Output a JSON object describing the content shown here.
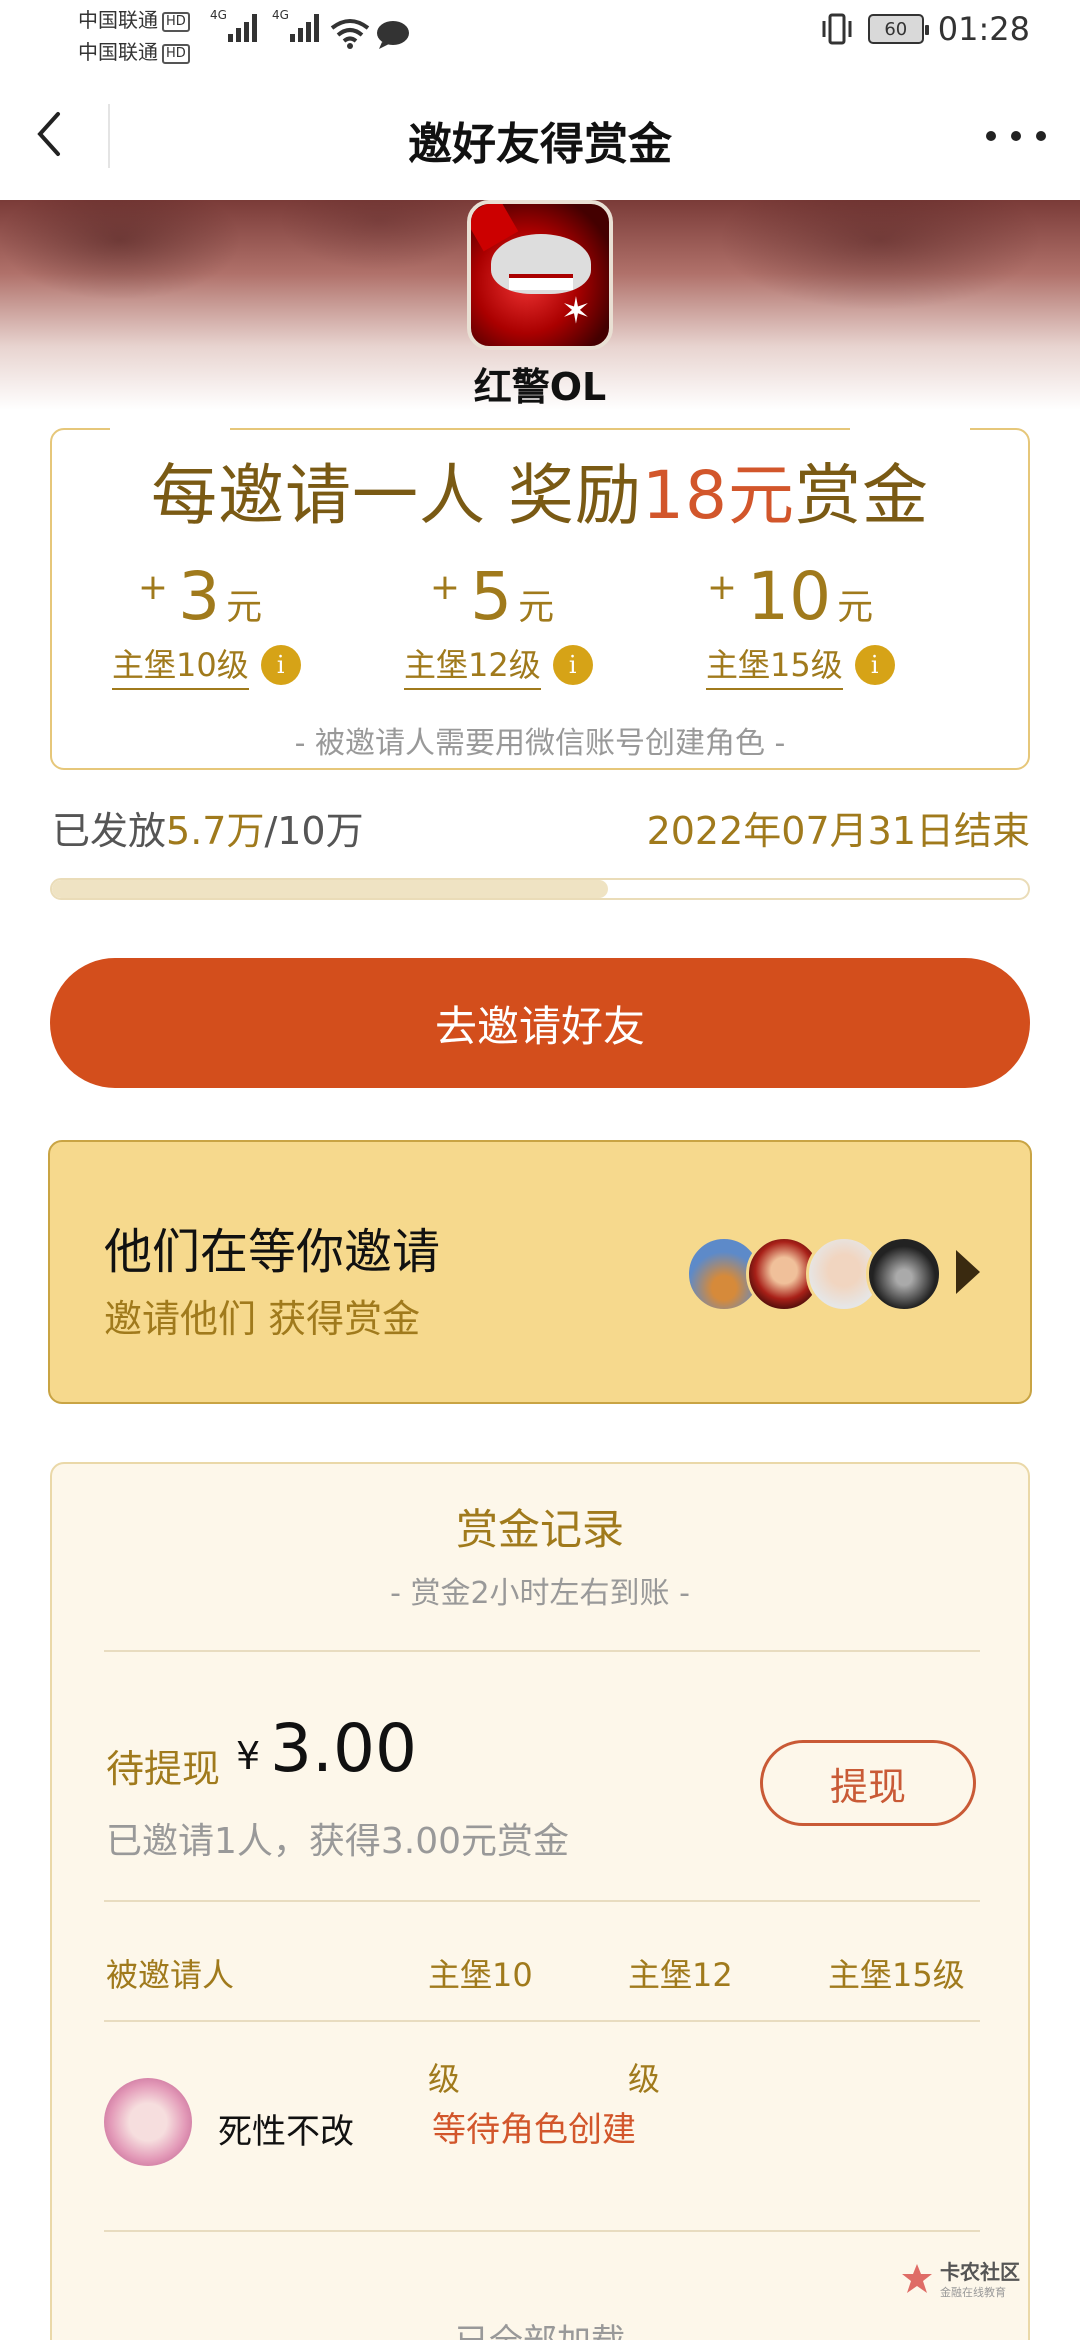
{
  "status_bar": {
    "carrier1": "中国联通",
    "carrier2": "中国联通",
    "hd": "HD",
    "net": "4G",
    "battery": "60",
    "time": "01:28"
  },
  "nav": {
    "title": "邀好友得赏金"
  },
  "game": {
    "name": "红警OL"
  },
  "reward": {
    "headline_pre": "每邀请一人 奖励",
    "headline_amount": "18元",
    "headline_post": "赏金",
    "tiers": [
      {
        "plus": "+",
        "amount": "3",
        "unit": "元",
        "label": "主堡10级"
      },
      {
        "plus": "+",
        "amount": "5",
        "unit": "元",
        "label": "主堡12级"
      },
      {
        "plus": "+",
        "amount": "10",
        "unit": "元",
        "label": "主堡15级"
      }
    ],
    "info_glyph": "i",
    "note": "- 被邀请人需要用微信账号创建角色 -"
  },
  "progress": {
    "issued_label": "已发放",
    "issued_value": "5.7万",
    "issued_total": "/10万",
    "end_date": "2022年07月31日结束",
    "fraction": 0.57,
    "fill_color": "#efe3c3"
  },
  "invite_button": {
    "label": "去邀请好友",
    "color": "#d34e1c"
  },
  "waiting": {
    "title": "他们在等你邀请",
    "subtitle": "邀请他们 获得赏金",
    "background": "#f6d98d"
  },
  "records": {
    "title": "赏金记录",
    "subtitle": "- 赏金2小时左右到账 -",
    "pending_label": "待提现",
    "currency": "¥",
    "pending_amount": "3.00",
    "summary": "已邀请1人，获得3.00元赏金",
    "withdraw_label": "提现",
    "columns": [
      "被邀请人",
      "主堡10",
      "主堡12",
      "主堡15级"
    ],
    "wrap_char": "级",
    "rows": [
      {
        "name": "死性不改",
        "status": "等待角色创建"
      }
    ],
    "footer": "已全部加载"
  },
  "watermark": {
    "name": "卡农社区",
    "tagline": "金融在线教育"
  },
  "colors": {
    "accent_gold": "#a07a1c",
    "accent_red": "#d2562b",
    "frame_gold": "#e6c77a"
  }
}
